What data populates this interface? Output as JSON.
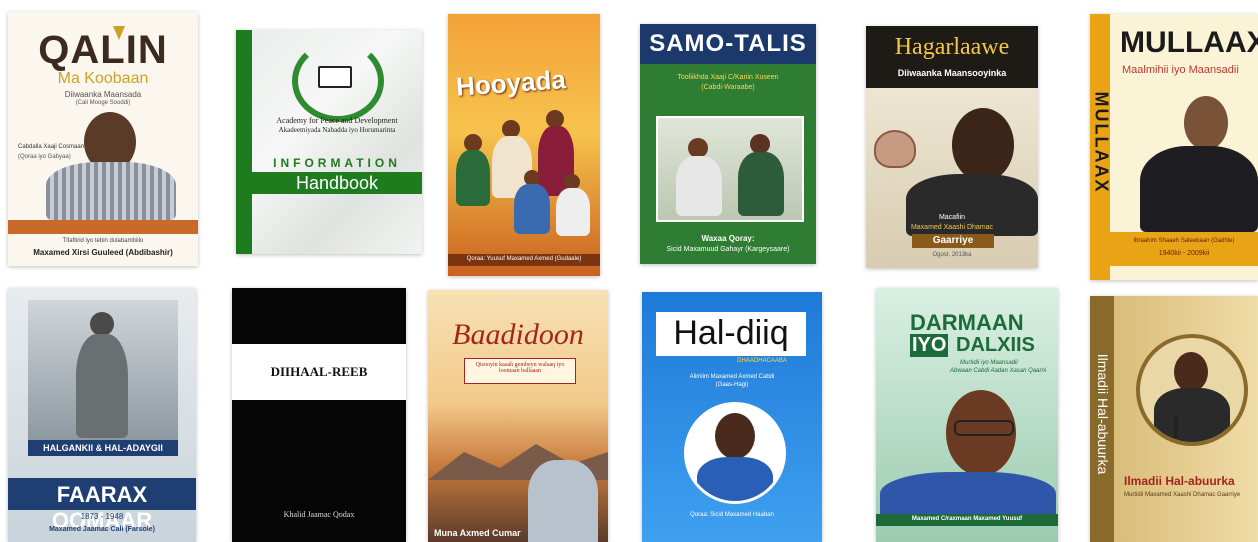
{
  "books": {
    "qalin": {
      "title": "QALIN",
      "subtitle": "Ma Koobaan",
      "series": "Diiwaanka Maansada",
      "series_note": "(Cali Mooge Sooddi)",
      "author_note": "Cabdalla Xaaji Cosmaan",
      "author_note2": "(Qoraa iyo Gabyaa)",
      "credit": "Tifaftirid iyo tebin dulabambiilo",
      "author": "Maxamed Xirsi Guuleed (Abdibashir)"
    },
    "handbook": {
      "org": "Academy for Peace and Development",
      "org2": "Akadeemiyada Nabadda iyo Horumarinta",
      "title_top": "INFORMATION",
      "title_main": "Handbook"
    },
    "hooyada": {
      "title": "Hooyada",
      "footer": "Qoraa: Yuusuf Maxamed Axmed (Gudaale)"
    },
    "samotalis": {
      "title": "SAMO-TALIS",
      "editor": "Tooliikhda Xaaji C/Kariin Xuseen",
      "editor2": "(Cabdi-Waraabe)",
      "by": "Waxaa Qoray:",
      "author": "Sicid Maxamuud Gahayr (Kargeysaare)"
    },
    "hagarlaawe": {
      "title": "Hagarlaawe",
      "subtitle": "Diiwaanka Maansooyinka",
      "by": "Macafiin",
      "author": "Maxamed Xaashi Dhamac",
      "nickname": "Gaarriye",
      "year": "Ogost, 2013ka"
    },
    "mullaax": {
      "title": "MULLAAX",
      "subtitle": "Maalmihii iyo Maansadii",
      "spine": "MULLAAX",
      "author": "Ibraahim Shaaeh Saleebaan (Gadhle)",
      "years": "1940kii - 2009kii"
    },
    "faarax": {
      "band": "HALGANKII & HAL-ADAYGII",
      "name": "FAARAX OOMAAR",
      "years": "1873 - 1948",
      "author": "Maxamed Jaamac Cali (Farsole)"
    },
    "diihaal": {
      "title": "DIIHAAL-REEB",
      "author": "Khalid Jaamac Qodax"
    },
    "baadidoon": {
      "title": "Baadidoon",
      "tagline": "Qisooyin kaaah gembeyn walaaq iyo loomaan ballaaan",
      "author": "Muna Axmed Cumar"
    },
    "haldiiq": {
      "title": "Hal-diiq",
      "subtitle": "DHAADHACAABA",
      "compiler": "Alimiim Maxamed Axmed Cabdi",
      "compiler2": "(Gaas-Hagi)",
      "footer": "Qoraa: Sicid Maxamed Haaban"
    },
    "darmaan": {
      "title1": "DARMAAN",
      "title2": "IYO",
      "title3": "DALXIIS",
      "subtitle": "Murtidii iyo Maansadii",
      "subtitle2": "Abwaan Cabdi Aadan Xasan Qaarni",
      "author": "Maxamed C/raxmaan Maxamed Yuusuf"
    },
    "ilmadii": {
      "spine": "Ilmadii Hal-abuurka",
      "title": "Ilmadii Hal-abuurka",
      "subtitle": "Murtidii Maxamed Xaashi Dhamac Gaarriye"
    }
  },
  "colors": {
    "qalin_dark": "#3d2a1e",
    "qalin_gold": "#c9a227",
    "handbook_green": "#1e7b1e",
    "samo_green": "#2e7d32",
    "samo_navy": "#1b3a6b",
    "mullaax_yellow": "#f2b51d",
    "faarax_navy": "#1f3f73",
    "baadidoon_red": "#a3251e",
    "haldiiq_blue": "#1e7ad8",
    "darmaan_green": "#1e6b3a",
    "ilmadii_gold": "#b08a3c"
  }
}
